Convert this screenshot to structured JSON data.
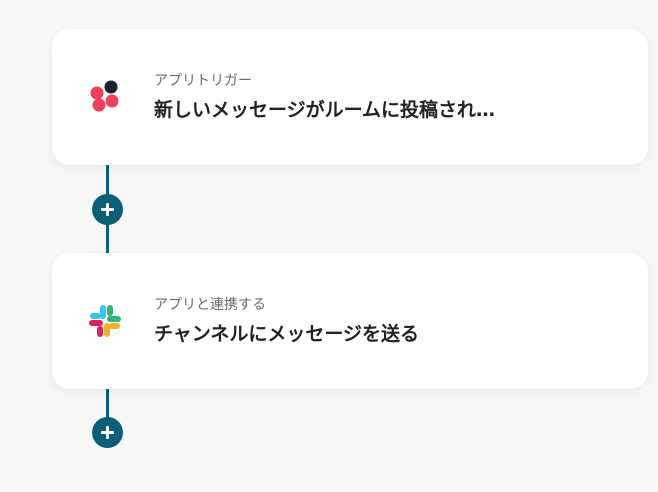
{
  "flow": {
    "steps": [
      {
        "type_label": "アプリトリガー",
        "title": "新しいメッセージがルームに投稿され…",
        "icon": "asana-like-red-dots-icon"
      },
      {
        "type_label": "アプリと連携する",
        "title": "チャンネルにメッセージを送る",
        "icon": "slack-icon"
      }
    ],
    "add_button": {
      "icon": "plus-icon"
    }
  },
  "colors": {
    "accent": "#0b5e77",
    "card_bg": "#ffffff",
    "page_bg": "#f7f7f8",
    "trigger_red": "#f0405a",
    "trigger_dark": "#1f1f2e",
    "slack_blue": "#36c5f0",
    "slack_green": "#2eb67d",
    "slack_yellow": "#ecb22e",
    "slack_red": "#e01e5a"
  }
}
